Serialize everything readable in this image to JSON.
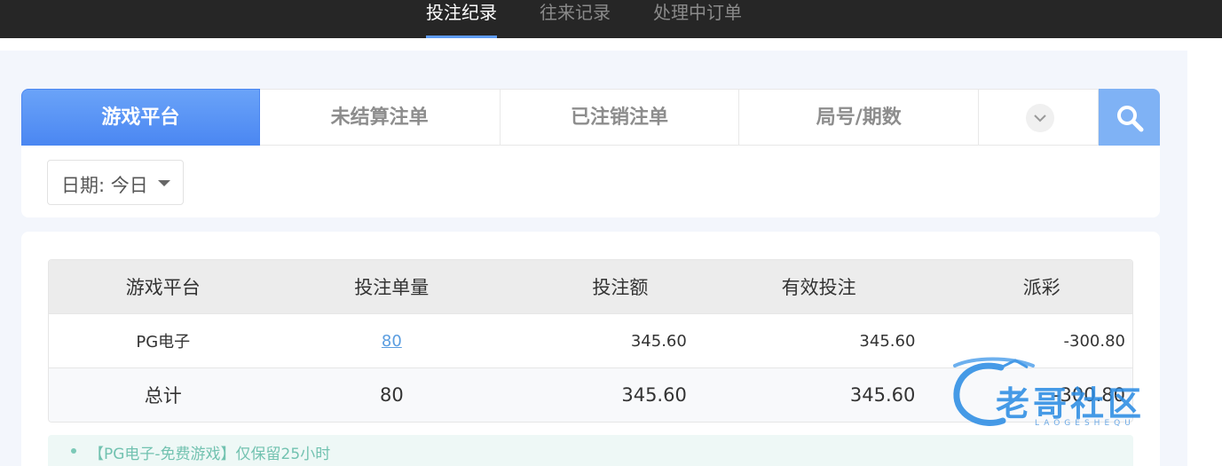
{
  "top_nav": {
    "tabs": [
      "投注纪录",
      "往来记录",
      "处理中订单"
    ]
  },
  "filter": {
    "subtabs": [
      "游戏平台",
      "未结算注单",
      "已注销注单",
      "局号/期数"
    ],
    "date_label": "日期: 今日"
  },
  "table": {
    "headers": [
      "游戏平台",
      "投注单量",
      "投注额",
      "有效投注",
      "派彩"
    ],
    "rows": [
      {
        "platform": "PG电子",
        "count": "80",
        "bet": "345.60",
        "valid": "345.60",
        "payout": "-300.80"
      }
    ],
    "total": {
      "label": "总计",
      "count": "80",
      "bet": "345.60",
      "valid": "345.60",
      "payout": "-300.80"
    }
  },
  "notice": "【PG电子-免费游戏】仅保留25小时",
  "watermark": {
    "text": "老哥社区",
    "sub": "LAOGESHEQU"
  },
  "colors": {
    "accent": "#4b87f2",
    "negative": "#e0566a",
    "link": "#5a9de0",
    "notice_text": "#72c2b0"
  }
}
